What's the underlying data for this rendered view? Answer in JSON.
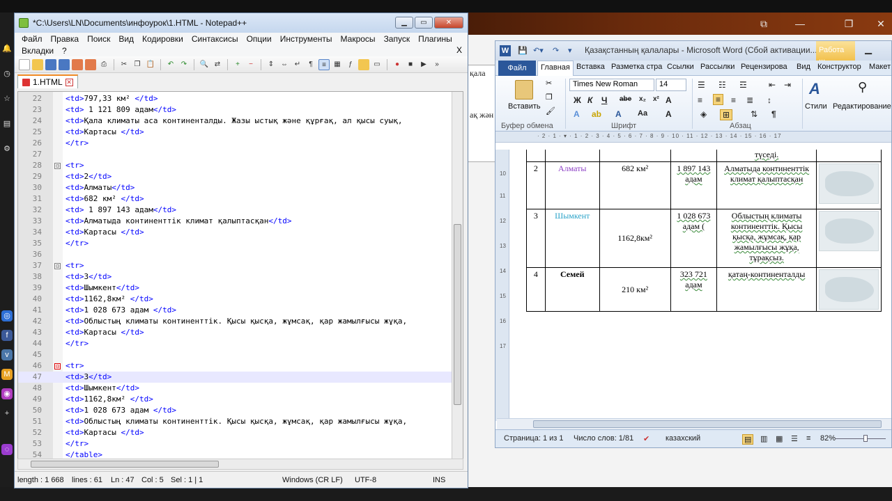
{
  "notepad": {
    "title": "*C:\\Users\\LN\\Documents\\инфоурок\\1.HTML - Notepad++",
    "menu": [
      "Файл",
      "Правка",
      "Поиск",
      "Вид",
      "Кодировки",
      "Синтаксисы",
      "Опции",
      "Инструменты",
      "Макросы",
      "Запуск",
      "Плагины",
      "Вкладки",
      "?"
    ],
    "menu_close": "X",
    "tab_label": "1.HTML",
    "lines": [
      {
        "n": "22",
        "fold": "",
        "parts": [
          [
            "tag",
            "<td>"
          ],
          [
            "txt",
            "797,33 км²  "
          ],
          [
            "tag",
            "</td>"
          ]
        ]
      },
      {
        "n": "23",
        "fold": "",
        "parts": [
          [
            "tag",
            "<td>"
          ],
          [
            "txt",
            " 1 121 809 адам"
          ],
          [
            "tag",
            "</td>"
          ]
        ]
      },
      {
        "n": "24",
        "fold": "",
        "parts": [
          [
            "tag",
            "<td>"
          ],
          [
            "txt",
            "Қала климаты аса континенталды. Жазы ыстық және құрғақ, ал қысы суық,"
          ]
        ]
      },
      {
        "n": "25",
        "fold": "",
        "parts": [
          [
            "tag",
            "<td>"
          ],
          [
            "txt",
            "Картасы "
          ],
          [
            "tag",
            "</td>"
          ]
        ]
      },
      {
        "n": "26",
        "fold": "",
        "parts": [
          [
            "tag",
            "</tr>"
          ]
        ]
      },
      {
        "n": "27",
        "fold": "",
        "parts": []
      },
      {
        "n": "28",
        "fold": "⊟",
        "parts": [
          [
            "tag",
            "<tr>"
          ]
        ]
      },
      {
        "n": "29",
        "fold": "",
        "parts": [
          [
            "tag",
            "<td>"
          ],
          [
            "txt",
            "2"
          ],
          [
            "tag",
            "</td>"
          ]
        ]
      },
      {
        "n": "30",
        "fold": "",
        "parts": [
          [
            "tag",
            "<td>"
          ],
          [
            "txt",
            "Алматы"
          ],
          [
            "tag",
            "</td>"
          ]
        ]
      },
      {
        "n": "31",
        "fold": "",
        "parts": [
          [
            "tag",
            "<td>"
          ],
          [
            "txt",
            "682 км²  "
          ],
          [
            "tag",
            "</td>"
          ]
        ]
      },
      {
        "n": "32",
        "fold": "",
        "parts": [
          [
            "tag",
            "<td>"
          ],
          [
            "txt",
            " 1 897 143 адам"
          ],
          [
            "tag",
            "</td>"
          ]
        ]
      },
      {
        "n": "33",
        "fold": "",
        "parts": [
          [
            "tag",
            "<td>"
          ],
          [
            "txt",
            "Алматыда континенттік климат қалыптасқан"
          ],
          [
            "tag",
            "</td>"
          ]
        ]
      },
      {
        "n": "34",
        "fold": "",
        "parts": [
          [
            "tag",
            "<td>"
          ],
          [
            "txt",
            "Картасы "
          ],
          [
            "tag",
            "</td>"
          ]
        ]
      },
      {
        "n": "35",
        "fold": "",
        "parts": [
          [
            "tag",
            "</tr>"
          ]
        ]
      },
      {
        "n": "36",
        "fold": "",
        "parts": []
      },
      {
        "n": "37",
        "fold": "⊟",
        "parts": [
          [
            "tag",
            "<tr>"
          ]
        ]
      },
      {
        "n": "38",
        "fold": "",
        "parts": [
          [
            "tag",
            "<td>"
          ],
          [
            "txt",
            "3"
          ],
          [
            "tag",
            "</td>"
          ]
        ]
      },
      {
        "n": "39",
        "fold": "",
        "parts": [
          [
            "tag",
            "<td>"
          ],
          [
            "txt",
            "Шымкент"
          ],
          [
            "tag",
            "</td>"
          ]
        ]
      },
      {
        "n": "40",
        "fold": "",
        "parts": [
          [
            "tag",
            "<td>"
          ],
          [
            "txt",
            "1162,8км² "
          ],
          [
            "tag",
            "</td>"
          ]
        ]
      },
      {
        "n": "41",
        "fold": "",
        "parts": [
          [
            "tag",
            "<td>"
          ],
          [
            "txt",
            "1 028 673 адам "
          ],
          [
            "tag",
            "</td>"
          ]
        ]
      },
      {
        "n": "42",
        "fold": "",
        "parts": [
          [
            "tag",
            "<td>"
          ],
          [
            "txt",
            "Облыстың климаты континенттік. Қысы қысқа, жұмсақ, қар жамылғысы жұқа,"
          ]
        ]
      },
      {
        "n": "43",
        "fold": "",
        "parts": [
          [
            "tag",
            "<td>"
          ],
          [
            "txt",
            "Картасы "
          ],
          [
            "tag",
            "</td>"
          ]
        ]
      },
      {
        "n": "44",
        "fold": "",
        "parts": [
          [
            "tag",
            "</tr>"
          ]
        ]
      },
      {
        "n": "45",
        "fold": "",
        "parts": []
      },
      {
        "n": "46",
        "fold": "⊟",
        "red": true,
        "parts": [
          [
            "tag",
            "<tr>"
          ]
        ]
      },
      {
        "n": "47",
        "fold": "",
        "cur": true,
        "parts": [
          [
            "tag",
            "<td>"
          ],
          [
            "txt",
            "3"
          ],
          [
            "tag",
            "</td>"
          ]
        ]
      },
      {
        "n": "48",
        "fold": "",
        "parts": [
          [
            "tag",
            "<td>"
          ],
          [
            "txt",
            "Шымкент"
          ],
          [
            "tag",
            "</td>"
          ]
        ]
      },
      {
        "n": "49",
        "fold": "",
        "parts": [
          [
            "tag",
            "<td>"
          ],
          [
            "txt",
            "1162,8км² "
          ],
          [
            "tag",
            "</td>"
          ]
        ]
      },
      {
        "n": "50",
        "fold": "",
        "parts": [
          [
            "tag",
            "<td>"
          ],
          [
            "txt",
            "1 028 673 адам "
          ],
          [
            "tag",
            "</td>"
          ]
        ]
      },
      {
        "n": "51",
        "fold": "",
        "parts": [
          [
            "tag",
            "<td>"
          ],
          [
            "txt",
            "Облыстың климаты континенттік. Қысы қысқа, жұмсақ, қар жамылғысы жұқа,"
          ]
        ]
      },
      {
        "n": "52",
        "fold": "",
        "parts": [
          [
            "tag",
            "<td>"
          ],
          [
            "txt",
            "Картасы "
          ],
          [
            "tag",
            "</td>"
          ]
        ]
      },
      {
        "n": "53",
        "fold": "",
        "parts": [
          [
            "tag",
            "</tr>"
          ]
        ]
      },
      {
        "n": "54",
        "fold": "",
        "parts": [
          [
            "tag",
            "</table>"
          ]
        ]
      }
    ],
    "status": {
      "length": "length : 1 668",
      "lines": "lines : 61",
      "ln": "Ln : 47",
      "col": "Col : 5",
      "sel": "Sel : 1 | 1",
      "eol": "Windows (CR LF)",
      "encoding": "UTF-8",
      "mode": "INS"
    }
  },
  "word": {
    "title": "Қазақстанның қалалары  -  Microsoft Word (Сбой активации...",
    "context_tab": "Работа ...",
    "tabs": [
      "Файл",
      "Главная",
      "Вставка",
      "Разметка стра",
      "Ссылки",
      "Рассылки",
      "Рецензирова",
      "Вид",
      "Конструктор",
      "Макет"
    ],
    "ribbon": {
      "paste": "Вставить",
      "clipboard_label": "Буфер обмена",
      "font_name": "Times New Roman",
      "font_size": "14",
      "font_label": "Шрифт",
      "paragraph_label": "Абзац",
      "styles": "Стили",
      "editing": "Редактирование"
    },
    "table_rows": [
      {
        "num": "",
        "city": "",
        "area": "",
        "pop": "",
        "climate": "түседі."
      },
      {
        "num": "2",
        "city": "Алматы",
        "area": "682 км²",
        "pop": "1 897 143 адам",
        "climate": "Алматыда континенттік климат қалыптасқан"
      },
      {
        "num": "3",
        "city": "Шымкент",
        "area": "1162,8км²",
        "pop": "1 028 673 адам (",
        "climate": "Облыстың климаты континенттік. Қысы қысқа, жұмсақ, қар жамылғысы жұқа, тұрақсыз."
      },
      {
        "num": "4",
        "city": "Семей",
        "area": "210 км²",
        "pop": "323 721 адам",
        "climate": "қатаң-континенталды"
      }
    ],
    "status": {
      "page": "Страница: 1 из 1",
      "words": "Число слов: 1/81",
      "lang": "казахский",
      "zoom": "82%"
    }
  },
  "background": {
    "doc_fragments": [
      "қала",
      "ақ жән"
    ]
  },
  "colors": {
    "tag": "#0000ff",
    "word_blue": "#2b579a",
    "city_purple": "#8c3fc5",
    "city_cyan": "#2aa3c9"
  }
}
